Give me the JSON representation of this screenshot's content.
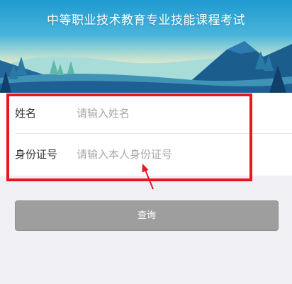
{
  "banner": {
    "title": "中等职业技术教育专业技能课程考试"
  },
  "form": {
    "name_label": "姓名",
    "name_placeholder": "请输入姓名",
    "id_label": "身份证号",
    "id_placeholder": "请输入本人身份证号"
  },
  "actions": {
    "query_label": "查询"
  },
  "colors": {
    "highlight_border": "#e8161f",
    "button_bg": "#9e9e9e",
    "page_bg": "#efeff4"
  }
}
